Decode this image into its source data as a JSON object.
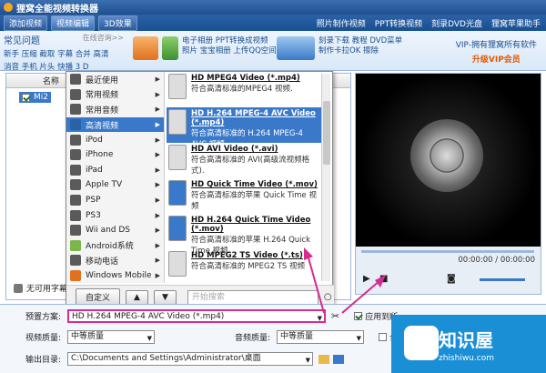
{
  "app": {
    "title": "狸窝全能视频转换器"
  },
  "toolbar": {
    "buttons": [
      "添加视频",
      "视频编辑",
      "3D效果"
    ],
    "links": [
      "照片制作视频",
      "PPT转换视频",
      "刻录DVD光盘",
      "狸窝苹果助手"
    ]
  },
  "adbar": {
    "faq_title": "常见问题",
    "faq_online": "在线咨询>>",
    "faq_row1": "新手 压缩 截取 字幕 合并 高清",
    "faq_row2": "消音 手机 片头 快播 3 D",
    "ad1": [
      "电子相册 PPT转换成视频",
      "照片 宝宝相册 上传QQ空间"
    ],
    "ad2": [
      "刻录下载 教程 DVD菜单",
      "制作卡拉OK 擦除"
    ],
    "vip_text": "VIP-拥有狸窝所有软件",
    "vip_upgrade": "升级VIP会员"
  },
  "filelist": {
    "header_name": "名称",
    "file_name": "Mi2",
    "no_subtitle": "无可用字幕"
  },
  "menu": {
    "categories": [
      "最近使用",
      "常用视频",
      "常用音频",
      "高清视频",
      "iPod",
      "iPhone",
      "iPad",
      "Apple TV",
      "PSP",
      "PS3",
      "Wii and DS",
      "Android系统",
      "移动电话",
      "Windows Mobile"
    ],
    "selected_category": "高清视频",
    "formats": [
      {
        "name": "HD MPEG4 Video (*.mp4)",
        "desc": "符合高清标准的MPEG4 视频."
      },
      {
        "name": "HD H.264 MPEG-4 AVC Video (*.mp4)",
        "desc": "符合高清标准的 H.264 MPEG-4 AVC 视频."
      },
      {
        "name": "HD AVI Video (*.avi)",
        "desc": "符合高清标准的 AVI(高级流视频格式)."
      },
      {
        "name": "HD Quick Time Video (*.mov)",
        "desc": "符合高清标准的苹果 Quick Time 视频"
      },
      {
        "name": "HD H.264 Quick Time Video (*.mov)",
        "desc": "符合高清标准的苹果 H.264 Quick Time 视频."
      },
      {
        "name": "HD MPEG2 TS Video (*.ts)",
        "desc": "符合高清标准的 MPEG2 TS 视频"
      }
    ],
    "custom_button": "自定义",
    "search_placeholder": "开始搜索"
  },
  "player": {
    "time": "00:00:00 / 00:00:00"
  },
  "settings": {
    "preset_label": "预置方案:",
    "preset_value": "HD H.264 MPEG-4 AVC Video (*.mp4)",
    "video_quality_label": "视频质量:",
    "video_quality_value": "中等质量",
    "audio_quality_label": "音频质量:",
    "audio_quality_value": "中等质量",
    "output_label": "输出目录:",
    "output_value": "C:\\Documents and Settings\\Administrator\\桌面",
    "apply_all": "应用到所",
    "merge": "合并"
  },
  "watermark": {
    "title": "知识屋",
    "sub": "zhishiwu.com"
  },
  "colors": {
    "accent": "#3a79c9",
    "arrow": "#d62b8f"
  }
}
